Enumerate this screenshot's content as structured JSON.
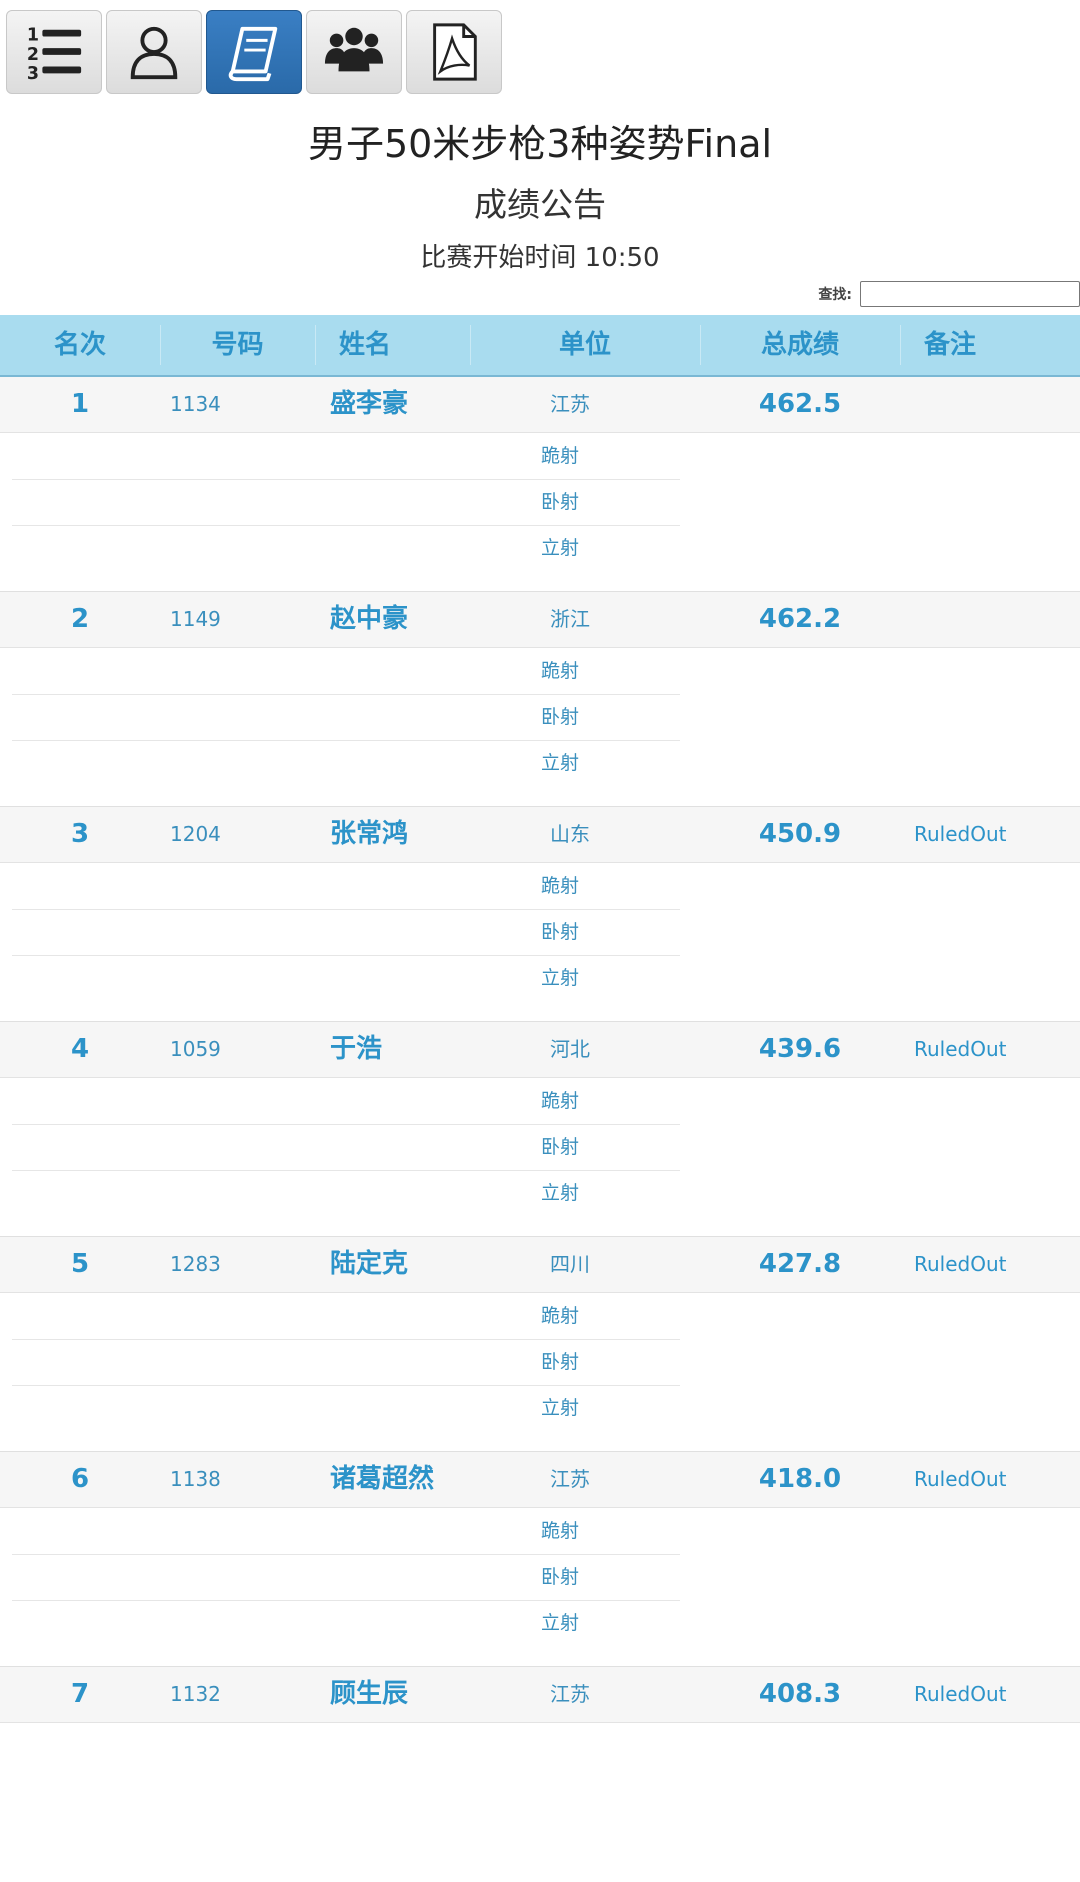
{
  "page": {
    "title": "男子50米步枪3种姿势Final",
    "subtitle": "成绩公告",
    "start_time": "比赛开始时间 10:50"
  },
  "search": {
    "label": "查找:",
    "value": ""
  },
  "toolbar": {
    "buttons": [
      {
        "icon": "ranked-list-icon",
        "active": false
      },
      {
        "icon": "person-icon",
        "active": false
      },
      {
        "icon": "book-icon",
        "active": true
      },
      {
        "icon": "team-icon",
        "active": false
      },
      {
        "icon": "pdf-icon",
        "active": false
      }
    ]
  },
  "table": {
    "headers": [
      "名次",
      "号码",
      "姓名",
      "单位",
      "总成绩",
      "备注"
    ],
    "sub_labels": [
      "跪射",
      "卧射",
      "立射"
    ],
    "rows": [
      {
        "rank": "1",
        "bib": "1134",
        "name": "盛李豪",
        "unit": "江苏",
        "total": "462.5",
        "note": ""
      },
      {
        "rank": "2",
        "bib": "1149",
        "name": "赵中豪",
        "unit": "浙江",
        "total": "462.2",
        "note": ""
      },
      {
        "rank": "3",
        "bib": "1204",
        "name": "张常鸿",
        "unit": "山东",
        "total": "450.9",
        "note": "RuledOut"
      },
      {
        "rank": "4",
        "bib": "1059",
        "name": "于浩",
        "unit": "河北",
        "total": "439.6",
        "note": "RuledOut"
      },
      {
        "rank": "5",
        "bib": "1283",
        "name": "陆定克",
        "unit": "四川",
        "total": "427.8",
        "note": "RuledOut"
      },
      {
        "rank": "6",
        "bib": "1138",
        "name": "诸葛超然",
        "unit": "江苏",
        "total": "418.0",
        "note": "RuledOut"
      },
      {
        "rank": "7",
        "bib": "1132",
        "name": "顾生辰",
        "unit": "江苏",
        "total": "408.3",
        "note": "RuledOut"
      }
    ]
  },
  "colors": {
    "accent": "#2c93c9",
    "header_bg": "#a9dcef",
    "active_button": "#2f74b8"
  }
}
